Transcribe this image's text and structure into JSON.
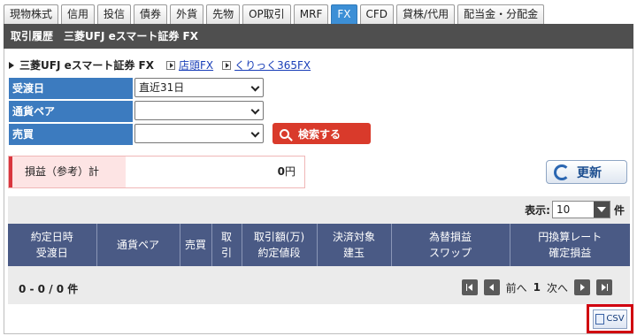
{
  "tabs": [
    "現物株式",
    "信用",
    "投信",
    "債券",
    "外貨",
    "先物",
    "OP取引",
    "MRF",
    "FX",
    "CFD",
    "貸株/代用",
    "配当金・分配金"
  ],
  "active_tab": "FX",
  "header": {
    "title": "取引履歴　三菱UFJ eスマート証券 FX"
  },
  "broker": {
    "name": "三菱UFJ eスマート証券 FX",
    "links": [
      "店頭FX",
      "くりっく365FX"
    ]
  },
  "form": {
    "rows": [
      {
        "label": "受渡日",
        "value": "直近31日"
      },
      {
        "label": "通貨ペア",
        "value": ""
      },
      {
        "label": "売買",
        "value": ""
      }
    ],
    "search_button": "検索する"
  },
  "pl": {
    "label": "損益（参考）計",
    "value": "0",
    "unit": "円"
  },
  "refresh_button": "更新",
  "display": {
    "label": "表示:",
    "value": "10",
    "unit": "件"
  },
  "table": {
    "headers": [
      [
        "約定日時",
        "受渡日"
      ],
      [
        "通貨ペア"
      ],
      [
        "売買"
      ],
      [
        "取",
        "引"
      ],
      [
        "取引額(万)",
        "約定値段"
      ],
      [
        "決済対象",
        "建玉"
      ],
      [
        "為替損益",
        "スワップ"
      ],
      [
        "円換算レート",
        "確定損益"
      ]
    ]
  },
  "pager": {
    "summary": "0 - 0 / 0 件",
    "prev": "前へ",
    "page": "1",
    "next": "次へ"
  },
  "csv_button": "CSV"
}
